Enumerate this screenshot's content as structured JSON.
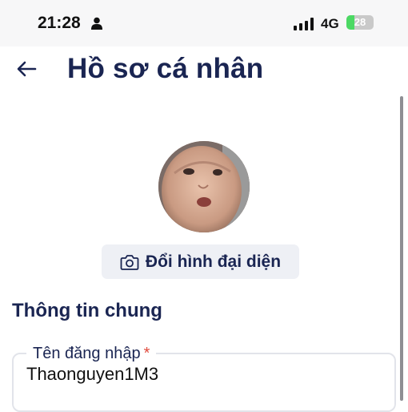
{
  "status_bar": {
    "time": "21:28",
    "network": "4G",
    "battery_text": "28",
    "battery_level": 0.28,
    "battery_color": "#4cd964",
    "icons": [
      "person-icon",
      "signal-icon",
      "battery-icon"
    ]
  },
  "header": {
    "back_icon": "arrow-left-icon",
    "title": "Hồ sơ cá nhân"
  },
  "avatar": {
    "change_label": "Đổi hình đại diện",
    "change_icon": "camera-icon"
  },
  "section": {
    "title": "Thông tin chung"
  },
  "fields": {
    "username": {
      "label": "Tên đăng nhập",
      "required_mark": "*",
      "value": "Thaonguyen1M3"
    }
  },
  "colors": {
    "primary_text": "#1a2552",
    "required": "#e04b3d",
    "button_bg": "#eef0f5"
  }
}
